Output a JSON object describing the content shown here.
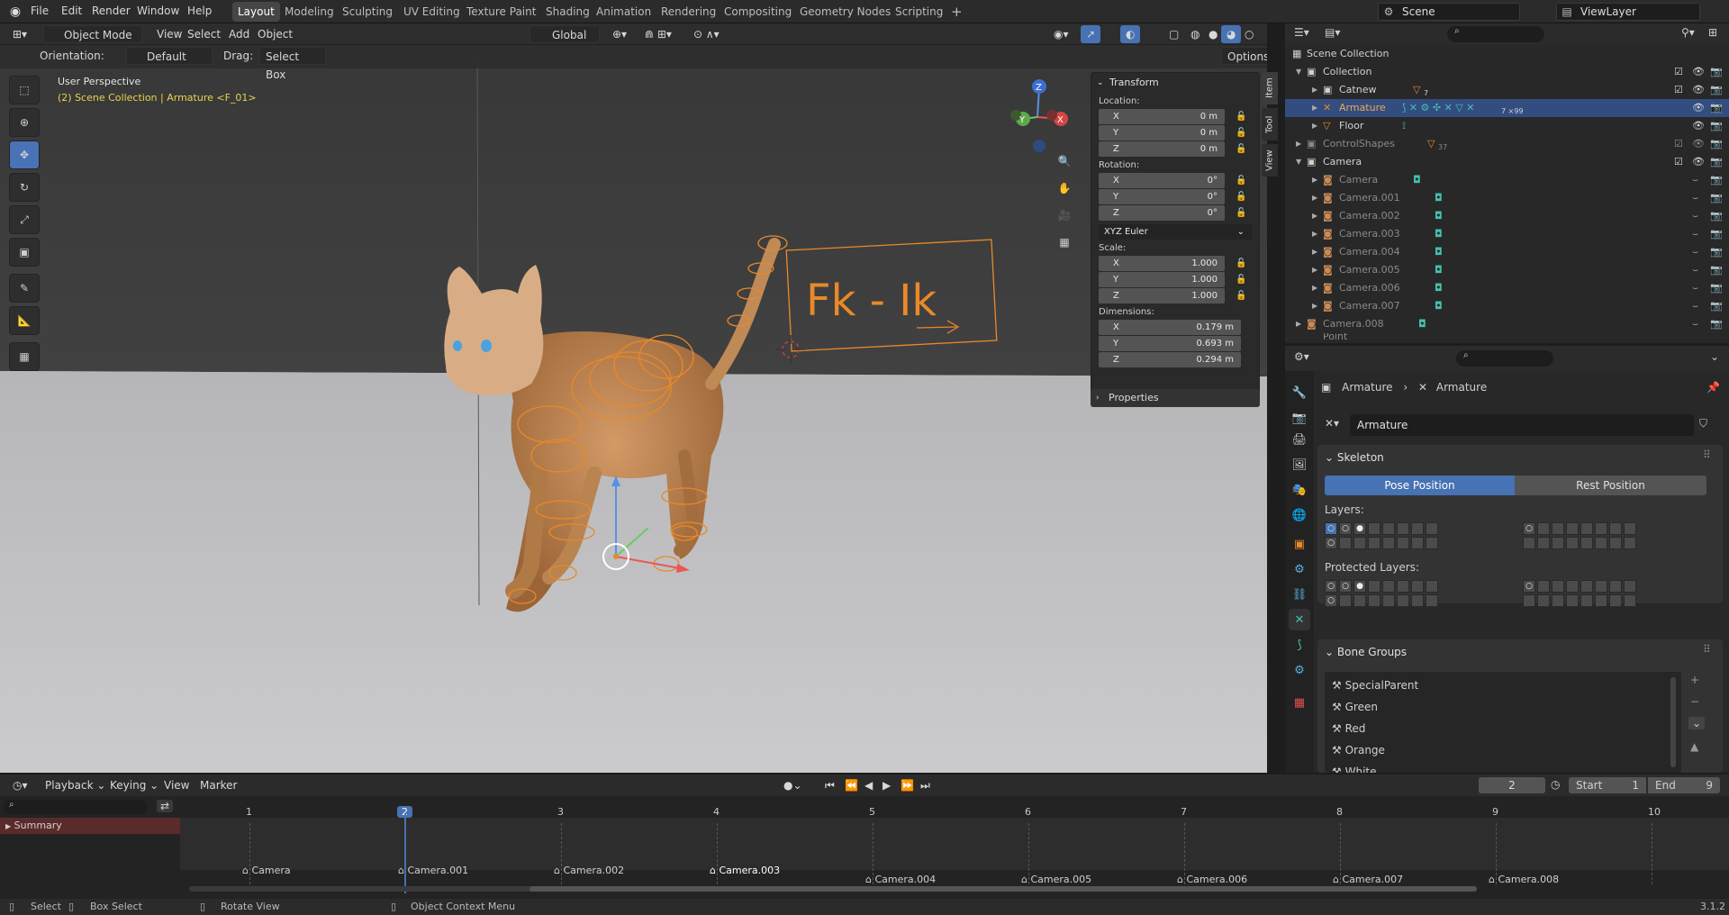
{
  "app_menu": [
    "File",
    "Edit",
    "Render",
    "Window",
    "Help"
  ],
  "workspaces": [
    "Layout",
    "Modeling",
    "Sculpting",
    "UV Editing",
    "Texture Paint",
    "Shading",
    "Animation",
    "Rendering",
    "Compositing",
    "Geometry Nodes",
    "Scripting"
  ],
  "active_workspace": "Layout",
  "scene": "Scene",
  "view_layer": "ViewLayer",
  "viewport": {
    "mode": "Object Mode",
    "menus": [
      "View",
      "Select",
      "Add",
      "Object"
    ],
    "transform_orientation": "Global",
    "orientation_label": "Orientation:",
    "orientation_value": "Default",
    "drag_label": "Drag:",
    "drag_value": "Select Box",
    "options_label": "Options",
    "perspective": "User Perspective",
    "context": "(2) Scene Collection | Armature <F_01>",
    "widget_text": "Fk  -  Ik",
    "gizmo_labels": [
      "Z",
      "Y",
      "X"
    ]
  },
  "npanel": {
    "tabs": [
      "Item",
      "Tool",
      "View"
    ],
    "transform_title": "Transform",
    "location_label": "Location:",
    "location": [
      {
        "ax": "X",
        "v": "0 m"
      },
      {
        "ax": "Y",
        "v": "0 m"
      },
      {
        "ax": "Z",
        "v": "0 m"
      }
    ],
    "rotation_label": "Rotation:",
    "rotation": [
      {
        "ax": "X",
        "v": "0°"
      },
      {
        "ax": "Y",
        "v": "0°"
      },
      {
        "ax": "Z",
        "v": "0°"
      }
    ],
    "rotation_mode": "XYZ Euler",
    "scale_label": "Scale:",
    "scale": [
      {
        "ax": "X",
        "v": "1.000"
      },
      {
        "ax": "Y",
        "v": "1.000"
      },
      {
        "ax": "Z",
        "v": "1.000"
      }
    ],
    "dimensions_label": "Dimensions:",
    "dimensions": [
      {
        "ax": "X",
        "v": "0.179 m"
      },
      {
        "ax": "Y",
        "v": "0.693 m"
      },
      {
        "ax": "Z",
        "v": "0.294 m"
      }
    ],
    "properties_title": "Properties"
  },
  "outliner": {
    "rows": [
      {
        "name": "Scene Collection",
        "extra": ""
      },
      {
        "name": "Collection",
        "extra": ""
      },
      {
        "name": "Catnew",
        "extra": "7"
      },
      {
        "name": "Armature",
        "extra": "7 ×99"
      },
      {
        "name": "Floor",
        "extra": ""
      },
      {
        "name": "ControlShapes",
        "extra": "37"
      },
      {
        "name": "Camera",
        "extra": ""
      },
      {
        "name": "Camera",
        "extra": ""
      },
      {
        "name": "Camera.001",
        "extra": ""
      },
      {
        "name": "Camera.002",
        "extra": ""
      },
      {
        "name": "Camera.003",
        "extra": ""
      },
      {
        "name": "Camera.004",
        "extra": ""
      },
      {
        "name": "Camera.005",
        "extra": ""
      },
      {
        "name": "Camera.006",
        "extra": ""
      },
      {
        "name": "Camera.007",
        "extra": ""
      },
      {
        "name": "Camera.008",
        "extra": ""
      },
      {
        "name": "Point",
        "extra": ""
      }
    ]
  },
  "properties": {
    "breadcrumb": [
      "Armature",
      "Armature"
    ],
    "data_name": "Armature",
    "skeleton_title": "Skeleton",
    "pose_position": "Pose Position",
    "rest_position": "Rest Position",
    "layers_label": "Layers:",
    "protected_layers_label": "Protected Layers:",
    "bone_groups_title": "Bone Groups",
    "bone_groups": [
      "SpecialParent",
      "Green",
      "Red",
      "Orange",
      "White"
    ]
  },
  "timeline": {
    "menus": [
      "Playback",
      "Keying",
      "View",
      "Marker"
    ],
    "current_frame": "2",
    "start_label": "Start",
    "start": "1",
    "end_label": "End",
    "end": "9",
    "frame_ticks": [
      "1",
      "2",
      "3",
      "4",
      "5",
      "6",
      "7",
      "8",
      "9",
      "10"
    ],
    "summary": "Summary",
    "markers": [
      "Camera",
      "Camera.001",
      "Camera.002",
      "Camera.003",
      "Camera.004",
      "Camera.005",
      "Camera.006",
      "Camera.007",
      "Camera.008"
    ]
  },
  "status": {
    "select": "Select",
    "box_select": "Box Select",
    "rotate_view": "Rotate View",
    "context_menu": "Object Context Menu",
    "version": "3.1.2"
  },
  "colors": {
    "accent": "#4772b3",
    "selection": "#334d80",
    "bone_orange": "#e8892a",
    "header": "#2b2b2b"
  }
}
